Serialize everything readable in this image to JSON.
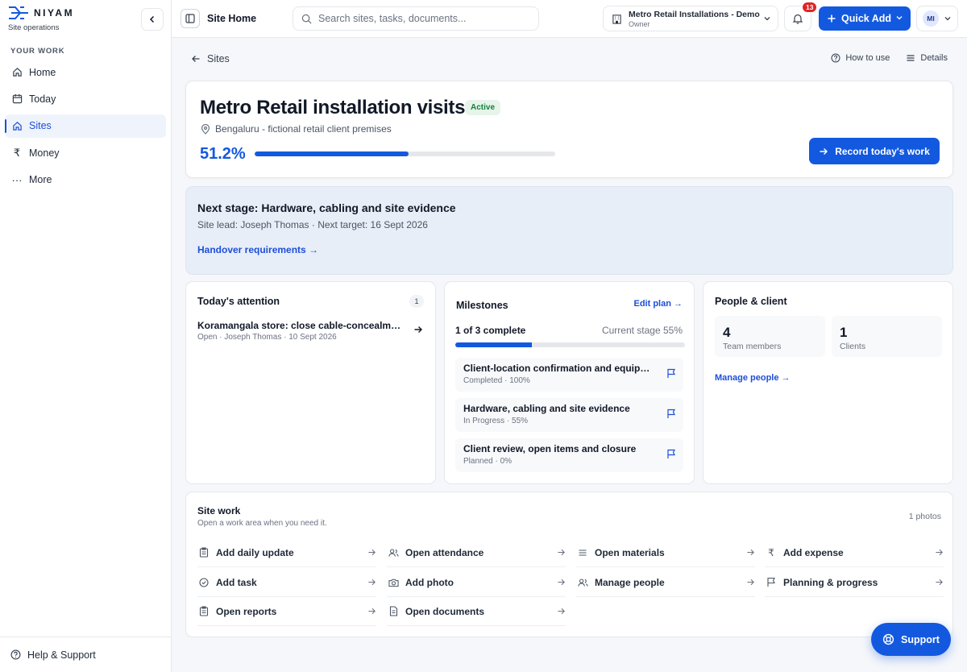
{
  "brand": {
    "name": "NIYAM",
    "subtitle": "Site operations"
  },
  "sidebar": {
    "section_label": "YOUR WORK",
    "items": [
      {
        "label": "Home",
        "icon": "home-icon"
      },
      {
        "label": "Today",
        "icon": "calendar-icon"
      },
      {
        "label": "Sites",
        "icon": "building-icon",
        "active": true
      },
      {
        "label": "Money",
        "icon": "rupee-icon"
      },
      {
        "label": "More",
        "icon": "more-dots-icon"
      }
    ],
    "footer": "Help & Support"
  },
  "topbar": {
    "page_name": "Site Home",
    "search_placeholder": "Search sites, tasks, documents...",
    "org_name": "Metro Retail Installations - Demo",
    "org_role": "Owner",
    "notification_count": "13",
    "quick_add_label": "Quick Add",
    "avatar_initials": "MI"
  },
  "breadcrumb": {
    "back_label": "Sites"
  },
  "header_links": {
    "how_to_use": "How to use",
    "details": "Details"
  },
  "site": {
    "title": "Metro Retail installation visits",
    "status": "Active",
    "location": "Bengaluru - fictional retail client premises",
    "progress_label": "51.2%",
    "progress_value": 51.2,
    "record_button": "Record today's work"
  },
  "next_stage": {
    "title": "Next stage: Hardware, cabling and site evidence",
    "subtitle": "Site lead: Joseph Thomas · Next target: 16 Sept 2026",
    "link": "Handover requirements →"
  },
  "attention": {
    "title": "Today's attention",
    "count": "1",
    "items": [
      {
        "title": "Koramangala store: close cable-concealment",
        "meta": "Open · Joseph Thomas · 10 Sept 2026"
      }
    ]
  },
  "milestones": {
    "title": "Milestones",
    "edit_label": "Edit plan",
    "summary": "1 of 3 complete",
    "current": "Current stage 55%",
    "progress_value": 33.3,
    "items": [
      {
        "title": "Client-location confirmation and equipment",
        "meta": "Completed · 100%"
      },
      {
        "title": "Hardware, cabling and site evidence",
        "meta": "In Progress · 55%"
      },
      {
        "title": "Client review, open items and closure",
        "meta": "Planned · 0%"
      }
    ]
  },
  "people": {
    "title": "People & client",
    "team_count": "4",
    "team_label": "Team members",
    "client_count": "1",
    "client_label": "Clients",
    "manage_label": "Manage people"
  },
  "site_work": {
    "title": "Site work",
    "subtitle": "Open a work area when you need it.",
    "photos": "1 photos",
    "items": [
      {
        "label": "Add daily update",
        "icon": "clipboard-icon"
      },
      {
        "label": "Open attendance",
        "icon": "users-icon"
      },
      {
        "label": "Open materials",
        "icon": "list-icon"
      },
      {
        "label": "Add expense",
        "icon": "rupee-icon"
      },
      {
        "label": "Add task",
        "icon": "check-circle-icon"
      },
      {
        "label": "Add photo",
        "icon": "camera-icon"
      },
      {
        "label": "Manage people",
        "icon": "users-icon"
      },
      {
        "label": "Planning & progress",
        "icon": "flag-icon"
      },
      {
        "label": "Open reports",
        "icon": "clipboard-icon"
      },
      {
        "label": "Open documents",
        "icon": "document-icon"
      }
    ]
  },
  "support": {
    "label": "Support"
  },
  "colors": {
    "accent": "#1359e0",
    "active_bg": "#e6f4ea",
    "active_text": "#15803d",
    "badge": "#dc2626"
  }
}
